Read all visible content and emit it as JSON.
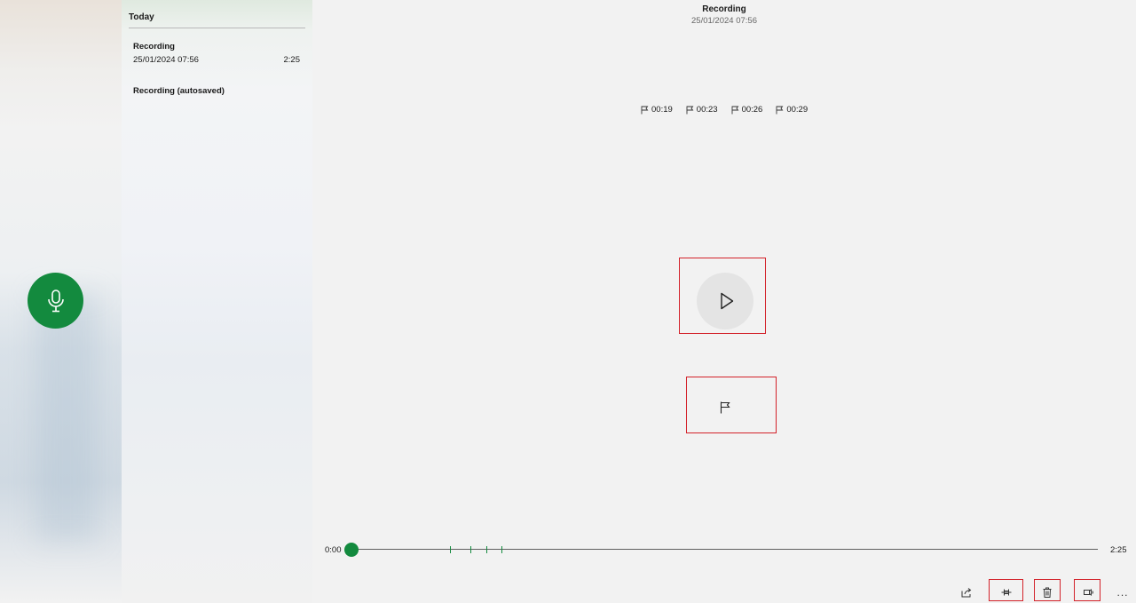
{
  "colors": {
    "accent": "#138a3e",
    "highlight": "#d3222a"
  },
  "rail": {
    "record_icon": "microphone-icon"
  },
  "list": {
    "group_header": "Today",
    "items": [
      {
        "name": "Recording",
        "date": "25/01/2024 07:56",
        "duration": "2:25"
      },
      {
        "name": "Recording (autosaved)"
      }
    ]
  },
  "player": {
    "title": "Recording",
    "subtitle": "25/01/2024 07:56",
    "markers": [
      "00:19",
      "00:23",
      "00:26",
      "00:29"
    ],
    "play_icon": "play-icon",
    "add_marker_icon": "flag-icon",
    "time_start": "0:00",
    "time_end": "2:25",
    "position_fraction": 0.0
  },
  "commands": {
    "share_icon": "share-icon",
    "trim_icon": "trim-icon",
    "delete_icon": "trash-icon",
    "speaker_icon": "speaker-icon",
    "more_label": "..."
  }
}
